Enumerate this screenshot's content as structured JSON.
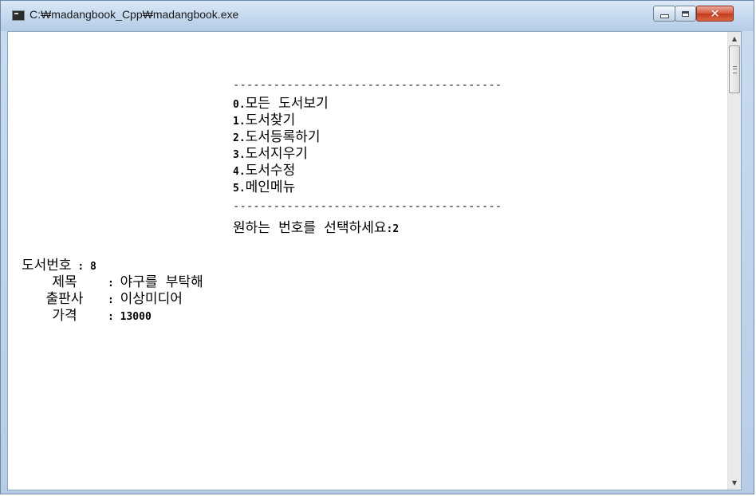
{
  "window": {
    "title": "C:₩madangbook_Cpp₩madangbook.exe",
    "controls": {
      "minimize_icon": "minimize-icon",
      "maximize_icon": "maximize-icon",
      "close_icon": "close-icon",
      "close_glyph": "✕"
    }
  },
  "console": {
    "menu": {
      "divider": "----------------------------------------",
      "items": [
        {
          "number": "0.",
          "label": "모든 도서보기"
        },
        {
          "number": "1.",
          "label": "도서찾기"
        },
        {
          "number": "2.",
          "label": "도서등록하기"
        },
        {
          "number": "3.",
          "label": "도서지우기"
        },
        {
          "number": "4.",
          "label": "도서수정"
        },
        {
          "number": "5.",
          "label": "메인메뉴"
        }
      ],
      "prompt_label": "원하는 번호를 선택하세요",
      "prompt_sep": ":",
      "prompt_value": "2"
    },
    "record": [
      {
        "label": "도서번호",
        "sep": ":",
        "value": "8"
      },
      {
        "label": "제목",
        "sep": ":",
        "value": "야구를 부탁해"
      },
      {
        "label": "출판사",
        "sep": ":",
        "value": "이상미디어"
      },
      {
        "label": "가격",
        "sep": ":",
        "value": "13000"
      }
    ]
  },
  "scrollbar": {
    "up_arrow": "▲",
    "down_arrow": "▼"
  },
  "colors": {
    "title_bar": "#c4d8ee",
    "close_button": "#c23a1e",
    "console_bg": "#ffffff",
    "console_text": "#000000"
  }
}
